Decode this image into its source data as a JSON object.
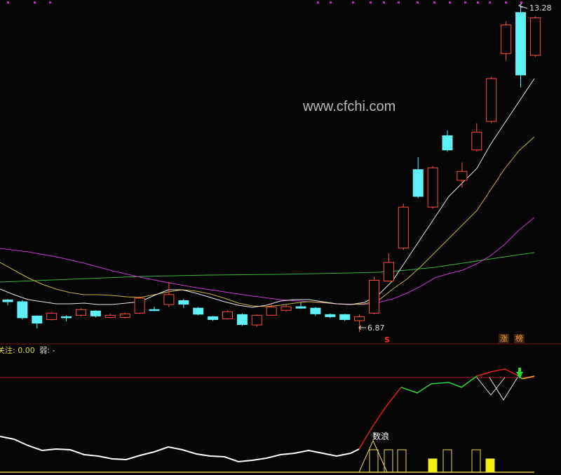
{
  "chart_data": {
    "type": "candlestick",
    "watermark": "www.cfchi.com",
    "price_high_label": "13.28",
    "price_low_label": "6.87",
    "candles": [
      {
        "o": 7.35,
        "c": 7.3,
        "h": 7.38,
        "l": 7.2
      },
      {
        "o": 7.3,
        "c": 6.85,
        "h": 7.35,
        "l": 6.8
      },
      {
        "o": 6.9,
        "c": 6.7,
        "h": 6.92,
        "l": 6.55
      },
      {
        "o": 6.8,
        "c": 6.98,
        "h": 7.02,
        "l": 6.78
      },
      {
        "o": 6.88,
        "c": 6.85,
        "h": 6.92,
        "l": 6.75
      },
      {
        "o": 6.92,
        "c": 7.08,
        "h": 7.12,
        "l": 6.88
      },
      {
        "o": 7.04,
        "c": 6.9,
        "h": 7.06,
        "l": 6.86
      },
      {
        "o": 6.86,
        "c": 6.92,
        "h": 6.96,
        "l": 6.84
      },
      {
        "o": 6.86,
        "c": 6.96,
        "h": 6.99,
        "l": 6.83
      },
      {
        "o": 6.98,
        "c": 7.4,
        "h": 7.45,
        "l": 6.96
      },
      {
        "o": 7.08,
        "c": 7.06,
        "h": 7.16,
        "l": 7.04
      },
      {
        "o": 7.22,
        "c": 7.5,
        "h": 7.85,
        "l": 7.15
      },
      {
        "o": 7.33,
        "c": 7.23,
        "h": 7.38,
        "l": 7.12
      },
      {
        "o": 7.12,
        "c": 6.95,
        "h": 7.15,
        "l": 6.92
      },
      {
        "o": 6.88,
        "c": 6.8,
        "h": 6.9,
        "l": 6.76
      },
      {
        "o": 6.82,
        "c": 7.02,
        "h": 7.06,
        "l": 6.8
      },
      {
        "o": 6.94,
        "c": 6.66,
        "h": 6.97,
        "l": 6.62
      },
      {
        "o": 6.65,
        "c": 6.92,
        "h": 6.95,
        "l": 6.6
      },
      {
        "o": 6.92,
        "c": 7.15,
        "h": 7.25,
        "l": 6.9
      },
      {
        "o": 7.06,
        "c": 7.16,
        "h": 7.22,
        "l": 7.02
      },
      {
        "o": 7.16,
        "c": 7.12,
        "h": 7.28,
        "l": 7.1
      },
      {
        "o": 7.12,
        "c": 6.96,
        "h": 7.15,
        "l": 6.9
      },
      {
        "o": 6.94,
        "c": 6.88,
        "h": 6.97,
        "l": 6.84
      },
      {
        "o": 6.94,
        "c": 6.8,
        "h": 6.96,
        "l": 6.76
      },
      {
        "o": 6.77,
        "c": 6.88,
        "h": 6.95,
        "l": 6.45
      },
      {
        "o": 6.98,
        "c": 7.9,
        "h": 8.0,
        "l": 6.95
      },
      {
        "o": 7.88,
        "c": 8.4,
        "h": 8.65,
        "l": 7.86
      },
      {
        "o": 8.8,
        "c": 9.95,
        "h": 10.05,
        "l": 8.75
      },
      {
        "o": 11.0,
        "c": 10.25,
        "h": 11.35,
        "l": 10.2
      },
      {
        "o": 9.95,
        "c": 11.05,
        "h": 11.1,
        "l": 9.9
      },
      {
        "o": 11.95,
        "c": 11.55,
        "h": 12.1,
        "l": 11.5
      },
      {
        "o": 10.7,
        "c": 10.95,
        "h": 11.2,
        "l": 10.5
      },
      {
        "o": 11.55,
        "c": 12.05,
        "h": 12.3,
        "l": 11.5
      },
      {
        "o": 12.35,
        "c": 13.55,
        "h": 13.6,
        "l": 12.3
      },
      {
        "o": 14.25,
        "c": 15.05,
        "h": 15.15,
        "l": 14.05
      },
      {
        "o": 15.4,
        "c": 13.65,
        "h": 15.6,
        "l": 13.3
      },
      {
        "o": 14.2,
        "c": 15.25,
        "h": 15.3,
        "l": 14.15
      }
    ],
    "price_range": [
      6.2,
      15.75
    ],
    "up_color": "#ff4d3d",
    "down_color": "#5ef0f4"
  },
  "indicator": {
    "label_prefix": "关注:",
    "label_value": "0.00",
    "label_weak": "弱:",
    "label_weak_value": "-",
    "annotation": "数浪",
    "bar_values": [
      1,
      1,
      1,
      0,
      0,
      1,
      0,
      1,
      1,
      0,
      1
    ],
    "filled_bars": [
      3,
      7
    ]
  },
  "markers": {
    "s_marker": "S",
    "tag1": "涨",
    "tag2": "榜"
  }
}
